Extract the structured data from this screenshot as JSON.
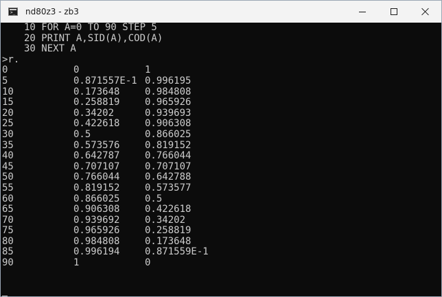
{
  "window": {
    "title": "nd80z3 - zb3",
    "icon": "terminal-icon"
  },
  "program": [
    "10 FOR A=0 TO 90 STEP 5",
    "20 PRINT A,SID(A),COD(A)",
    "30 NEXT A"
  ],
  "prompt": ">r.",
  "output": [
    {
      "a": "0",
      "sin": "0",
      "cos": "1"
    },
    {
      "a": "5",
      "sin": "0.871557E-1",
      "cos": "0.996195"
    },
    {
      "a": "10",
      "sin": "0.173648",
      "cos": "0.984808"
    },
    {
      "a": "15",
      "sin": "0.258819",
      "cos": "0.965926"
    },
    {
      "a": "20",
      "sin": "0.34202",
      "cos": "0.939693"
    },
    {
      "a": "25",
      "sin": "0.422618",
      "cos": "0.906308"
    },
    {
      "a": "30",
      "sin": "0.5",
      "cos": "0.866025"
    },
    {
      "a": "35",
      "sin": "0.573576",
      "cos": "0.819152"
    },
    {
      "a": "40",
      "sin": "0.642787",
      "cos": "0.766044"
    },
    {
      "a": "45",
      "sin": "0.707107",
      "cos": "0.707107"
    },
    {
      "a": "50",
      "sin": "0.766044",
      "cos": "0.642788"
    },
    {
      "a": "55",
      "sin": "0.819152",
      "cos": "0.573577"
    },
    {
      "a": "60",
      "sin": "0.866025",
      "cos": "0.5"
    },
    {
      "a": "65",
      "sin": "0.906308",
      "cos": "0.422618"
    },
    {
      "a": "70",
      "sin": "0.939692",
      "cos": "0.34202"
    },
    {
      "a": "75",
      "sin": "0.965926",
      "cos": "0.258819"
    },
    {
      "a": "80",
      "sin": "0.984808",
      "cos": "0.173648"
    },
    {
      "a": "85",
      "sin": "0.996194",
      "cos": "0.871559E-1"
    },
    {
      "a": "90",
      "sin": "1",
      "cos": "0"
    }
  ],
  "colors": {
    "console_bg": "#0c0c0c",
    "console_fg": "#cccccc",
    "titlebar_bg": "#f3f3f3"
  }
}
